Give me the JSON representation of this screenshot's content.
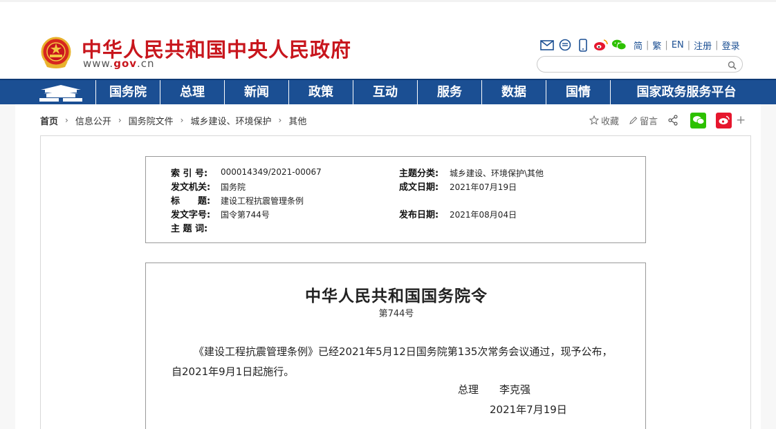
{
  "header": {
    "site_title": "中华人民共和国中央人民政府",
    "url_prefix": "www.",
    "url_domain": "gov",
    "url_suffix": ".cn",
    "lang_simplified": "简",
    "lang_traditional": "繁",
    "lang_english": "EN",
    "register": "注册",
    "login": "登录",
    "separator": "|",
    "search_placeholder": ""
  },
  "nav": {
    "items": [
      "国务院",
      "总理",
      "新闻",
      "政策",
      "互动",
      "服务",
      "数据",
      "国情"
    ],
    "last": "国家政务服务平台"
  },
  "breadcrumb": {
    "items": [
      "首页",
      "信息公开",
      "国务院文件",
      "城乡建设、环境保护",
      "其他"
    ],
    "arrow": "›"
  },
  "share": {
    "favorite": "收藏",
    "comment": "留言",
    "more": "+"
  },
  "meta": {
    "index_label": "索 引 号:",
    "index_value": "000014349/2021-00067",
    "topic_label": "主题分类:",
    "topic_value": "城乡建设、环境保护\\其他",
    "issuer_label": "发文机关:",
    "issuer_value": "国务院",
    "written_label": "成文日期:",
    "written_value": "2021年07月19日",
    "title_label": "标　　题:",
    "title_value": "建设工程抗震管理条例",
    "docno_label": "发文字号:",
    "docno_value": "国令第744号",
    "published_label": "发布日期:",
    "published_value": "2021年08月04日",
    "keywords_label": "主 题 词:",
    "keywords_value": ""
  },
  "document": {
    "title": "中华人民共和国国务院令",
    "number": "第744号",
    "body": "《建设工程抗震管理条例》已经2021年5月12日国务院第135次常务会议通过，现予公布，自2021年9月1日起施行。",
    "sign_role": "总理",
    "sign_name": "李克强",
    "date": "2021年7月19日"
  },
  "colors": {
    "brand_red": "#c8161d",
    "nav_blue": "#1b4f93",
    "wechat_green": "#2dc100",
    "weibo_red": "#e6162d"
  }
}
